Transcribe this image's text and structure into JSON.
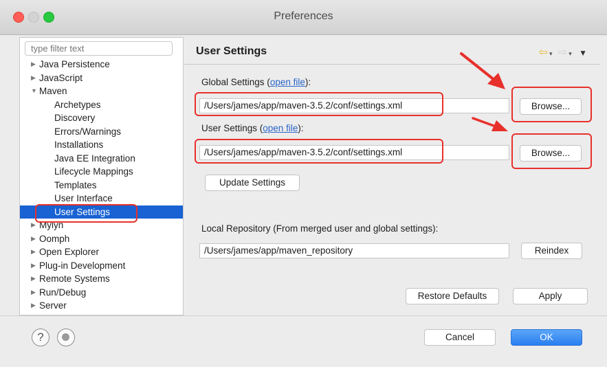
{
  "window": {
    "title": "Preferences"
  },
  "sidebar": {
    "filter_placeholder": "type filter text",
    "items": [
      {
        "label": "Java Persistence",
        "level": 0,
        "expander": "collapsed"
      },
      {
        "label": "JavaScript",
        "level": 0,
        "expander": "collapsed"
      },
      {
        "label": "Maven",
        "level": 0,
        "expander": "expanded"
      },
      {
        "label": "Archetypes",
        "level": 1
      },
      {
        "label": "Discovery",
        "level": 1
      },
      {
        "label": "Errors/Warnings",
        "level": 1
      },
      {
        "label": "Installations",
        "level": 1
      },
      {
        "label": "Java EE Integration",
        "level": 1
      },
      {
        "label": "Lifecycle Mappings",
        "level": 1
      },
      {
        "label": "Templates",
        "level": 1
      },
      {
        "label": "User Interface",
        "level": 1
      },
      {
        "label": "User Settings",
        "level": 1,
        "selected": true
      },
      {
        "label": "Mylyn",
        "level": 0,
        "expander": "collapsed"
      },
      {
        "label": "Oomph",
        "level": 0,
        "expander": "collapsed"
      },
      {
        "label": "Open Explorer",
        "level": 0,
        "expander": "collapsed"
      },
      {
        "label": "Plug-in Development",
        "level": 0,
        "expander": "collapsed"
      },
      {
        "label": "Remote Systems",
        "level": 0,
        "expander": "collapsed"
      },
      {
        "label": "Run/Debug",
        "level": 0,
        "expander": "collapsed"
      },
      {
        "label": "Server",
        "level": 0,
        "expander": "collapsed"
      }
    ]
  },
  "content": {
    "title": "User Settings",
    "global": {
      "label_prefix": "Global Settings (",
      "link": "open file",
      "label_suffix": "):",
      "value": "/Users/james/app/maven-3.5.2/conf/settings.xml",
      "browse": "Browse..."
    },
    "user": {
      "label_prefix": "User Settings (",
      "link": "open file",
      "label_suffix": "):",
      "value": "/Users/james/app/maven-3.5.2/conf/settings.xml",
      "browse": "Browse..."
    },
    "update_button": "Update Settings",
    "local_repo": {
      "label": "Local Repository (From merged user and global settings):",
      "value": "/Users/james/app/maven_repository",
      "reindex": "Reindex"
    },
    "restore_defaults": "Restore Defaults",
    "apply": "Apply"
  },
  "footer": {
    "cancel": "Cancel",
    "ok": "OK"
  },
  "colors": {
    "selection": "#1862d3",
    "highlight": "#e8302b",
    "link": "#2a65c9",
    "ok_button": "#2a7ef0"
  },
  "icons": [
    "back-arrow-icon",
    "forward-arrow-icon",
    "view-menu-icon",
    "help-icon",
    "record-icon"
  ]
}
